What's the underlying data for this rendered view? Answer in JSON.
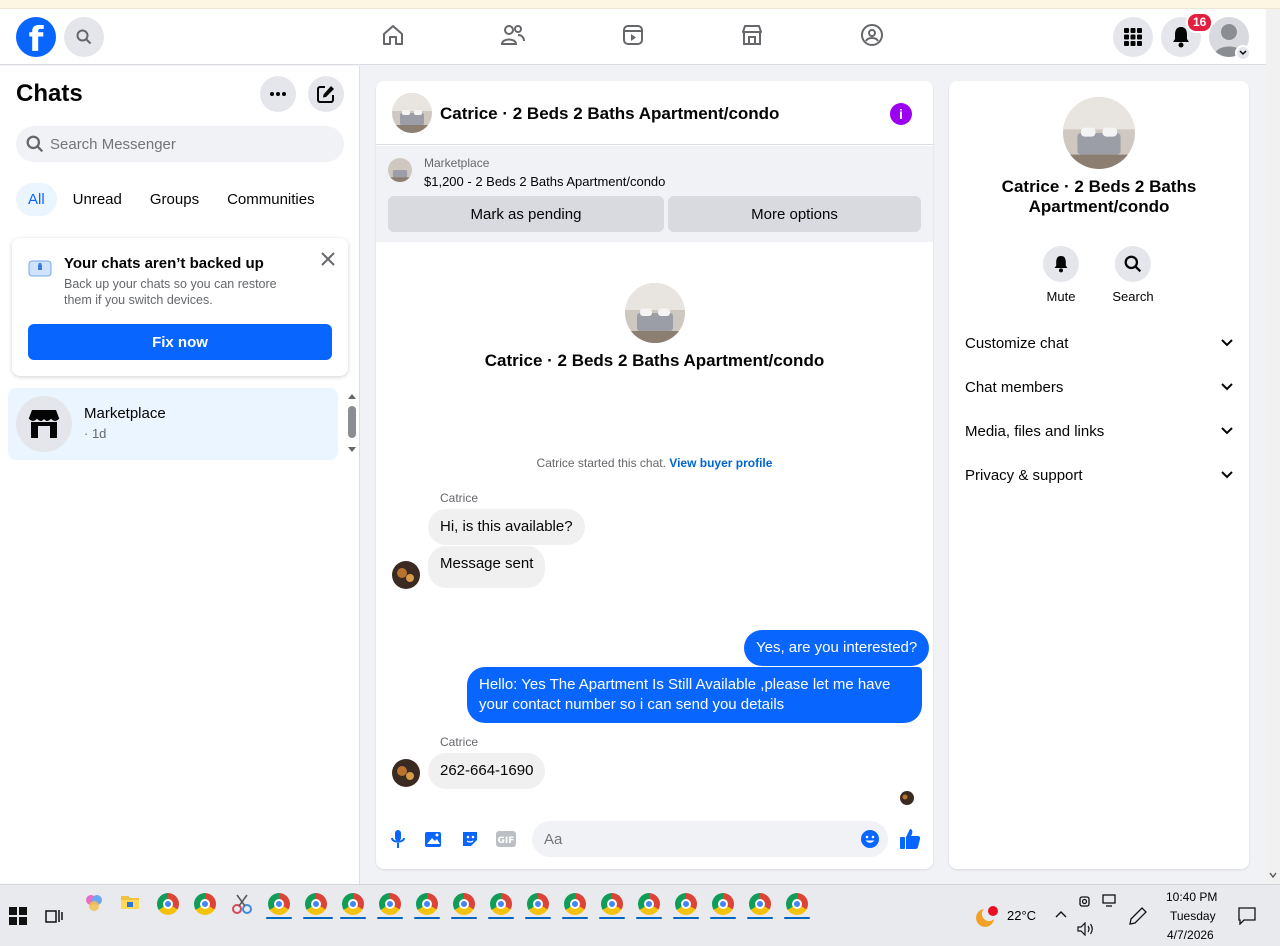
{
  "header": {
    "logo": "f",
    "notifications_count": "16",
    "colors": {
      "brand": "#0866ff",
      "badge": "#e41e3f"
    }
  },
  "left": {
    "title": "Chats",
    "search_placeholder": "Search Messenger",
    "tabs": [
      "All",
      "Unread",
      "Groups",
      "Communities"
    ],
    "backup": {
      "title": "Your chats aren’t backed up",
      "desc": "Back up your chats so you can restore them if you switch devices.",
      "button": "Fix now"
    },
    "chat_item": {
      "name": "Marketplace",
      "time": "· 1d"
    }
  },
  "conversation": {
    "title": "Catrice · 2 Beds 2 Baths Apartment/condo",
    "marketplace_label": "Marketplace",
    "listing": "$1,200 - 2 Beds 2 Baths Apartment/condo",
    "btn_pending": "Mark as pending",
    "btn_more": "More options",
    "profile_name": "Catrice · 2 Beds 2 Baths Apartment/condo",
    "started_text": "Catrice started this chat.",
    "started_link": "View buyer profile",
    "messages": [
      {
        "sender": "Catrice",
        "text": "Hi, is this available?"
      },
      {
        "text": "Message sent"
      },
      {
        "text": "Yes, are you interested?"
      },
      {
        "text": "Hello: Yes The Apartment Is Still Available ,please let me have your contact number so i can send you details"
      },
      {
        "sender": "Catrice",
        "text": "262-664-1690"
      }
    ],
    "composer_placeholder": "Aa"
  },
  "right": {
    "name": "Catrice · 2 Beds 2 Baths Apartment/condo",
    "actions": [
      "Mute",
      "Search"
    ],
    "sections": [
      "Customize chat",
      "Chat members",
      "Media, files and links",
      "Privacy & support"
    ]
  },
  "taskbar": {
    "weather": "22°C",
    "time": "10:40 PM",
    "day": "Tuesday",
    "date": "4/7/2026"
  }
}
